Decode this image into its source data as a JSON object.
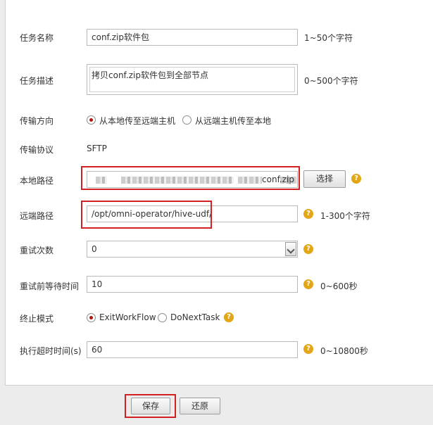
{
  "form": {
    "task_name": {
      "label": "任务名称",
      "value": "conf.zip软件包",
      "hint": "1~50个字符"
    },
    "task_desc": {
      "label": "任务描述",
      "value": "拷贝conf.zip软件包到全部节点",
      "hint": "0~500个字符"
    },
    "direction": {
      "label": "传输方向",
      "option1": "从本地传至远端主机",
      "option2": "从远端主机传至本地",
      "selected": "option1"
    },
    "protocol": {
      "label": "传输协议",
      "value": "SFTP"
    },
    "local_path": {
      "label": "本地路径",
      "value_suffix": "conf.zip",
      "browse_label": "选择"
    },
    "remote_path": {
      "label": "远端路径",
      "value": "/opt/omni-operator/hive-udf/",
      "hint": "1-300个字符"
    },
    "retry_count": {
      "label": "重试次数",
      "value": "0"
    },
    "retry_wait": {
      "label": "重试前等待时间",
      "value": "10",
      "hint": "0~600秒"
    },
    "stop_mode": {
      "label": "终止模式",
      "option1": "ExitWorkFlow",
      "option2": "DoNextTask",
      "selected": "option1"
    },
    "timeout": {
      "label": "执行超时时间(s)",
      "value": "60",
      "hint": "0~10800秒"
    }
  },
  "buttons": {
    "save": "保存",
    "reset": "还原"
  },
  "icons": {
    "help": "question-icon",
    "help_color": "#e3a617",
    "highlight_color": "#d42020"
  }
}
